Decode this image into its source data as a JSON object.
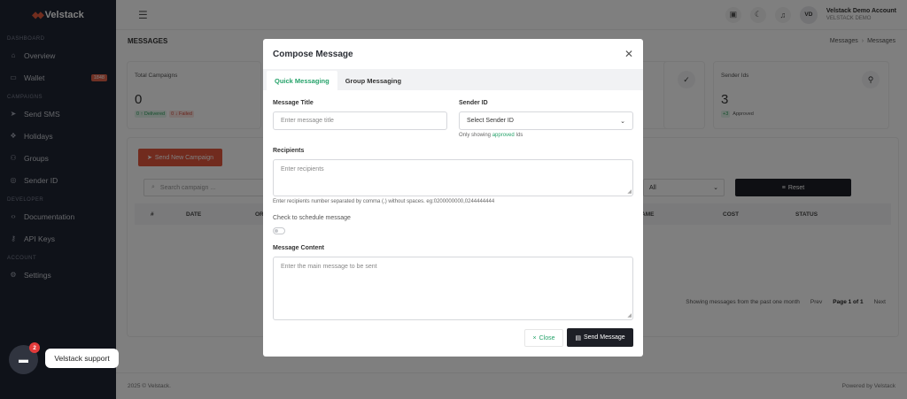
{
  "brand": {
    "name": "Velstack"
  },
  "sidebar": {
    "sections": [
      {
        "label": "DASHBOARD"
      },
      {
        "label": "CAMPAIGNS"
      },
      {
        "label": "DEVELOPER"
      },
      {
        "label": "ACCOUNT"
      }
    ],
    "items": [
      {
        "label": "Overview",
        "icon": "bank-icon"
      },
      {
        "label": "Wallet",
        "icon": "wallet-icon",
        "badge": "1848"
      },
      {
        "label": "Send SMS",
        "icon": "send-icon"
      },
      {
        "label": "Holidays",
        "icon": "gift-icon"
      },
      {
        "label": "Groups",
        "icon": "users-icon"
      },
      {
        "label": "Sender ID",
        "icon": "id-icon"
      },
      {
        "label": "Documentation",
        "icon": "code-icon"
      },
      {
        "label": "API Keys",
        "icon": "key-icon"
      },
      {
        "label": "Settings",
        "icon": "gear-icon"
      }
    ]
  },
  "topbar": {
    "account_initials": "VD",
    "account_name": "Velstack Demo Account",
    "account_sub": "VELSTACK DEMO"
  },
  "page": {
    "title": "MESSAGES",
    "breadcrumb": [
      "Messages",
      "Messages"
    ]
  },
  "cards": {
    "total_campaigns": {
      "label": "Total Campaigns",
      "value": "0",
      "delivered": "0 ↑ Delivered",
      "failed": "0 ↓ Failed"
    },
    "sender_ids": {
      "label": "Sender Ids",
      "value": "3",
      "approved_count": "+3",
      "approved_label": "Approved"
    }
  },
  "panel": {
    "new_campaign_label": "Send New Campaign",
    "search_placeholder": "Search campaign ...",
    "filter_value": "All",
    "reset_label": "Reset",
    "columns": [
      "#",
      "DATE",
      "OR",
      "AME",
      "COST",
      "STATUS"
    ],
    "pager_note": "Showing messages from the past one month",
    "prev": "Prev",
    "page": "Page 1 of 1",
    "next": "Next"
  },
  "footer": {
    "copyright": "2025 © Velstack.",
    "powered": "Powered by Velstack"
  },
  "modal": {
    "title": "Compose Message",
    "tabs": [
      "Quick Messaging",
      "Group Messaging"
    ],
    "message_title_label": "Message Title",
    "message_title_placeholder": "Enter message title",
    "sender_id_label": "Sender ID",
    "sender_id_value": "Select Sender ID",
    "sender_hint_prefix": "Only showing",
    "sender_hint_ok": "approved",
    "sender_hint_suffix": "Ids",
    "recipients_label": "Recipients",
    "recipients_placeholder": "Enter recipients",
    "recipients_hint": "Enter recipients number separated by comma (,) without spaces. eg:0200000000,0244444444",
    "schedule_label": "Check to schedule message",
    "content_label": "Message Content",
    "content_placeholder": "Enter the main message to be sent",
    "close_label": "Close",
    "send_label": "Send Message"
  },
  "support": {
    "label": "Velstack support",
    "badge": "2"
  }
}
